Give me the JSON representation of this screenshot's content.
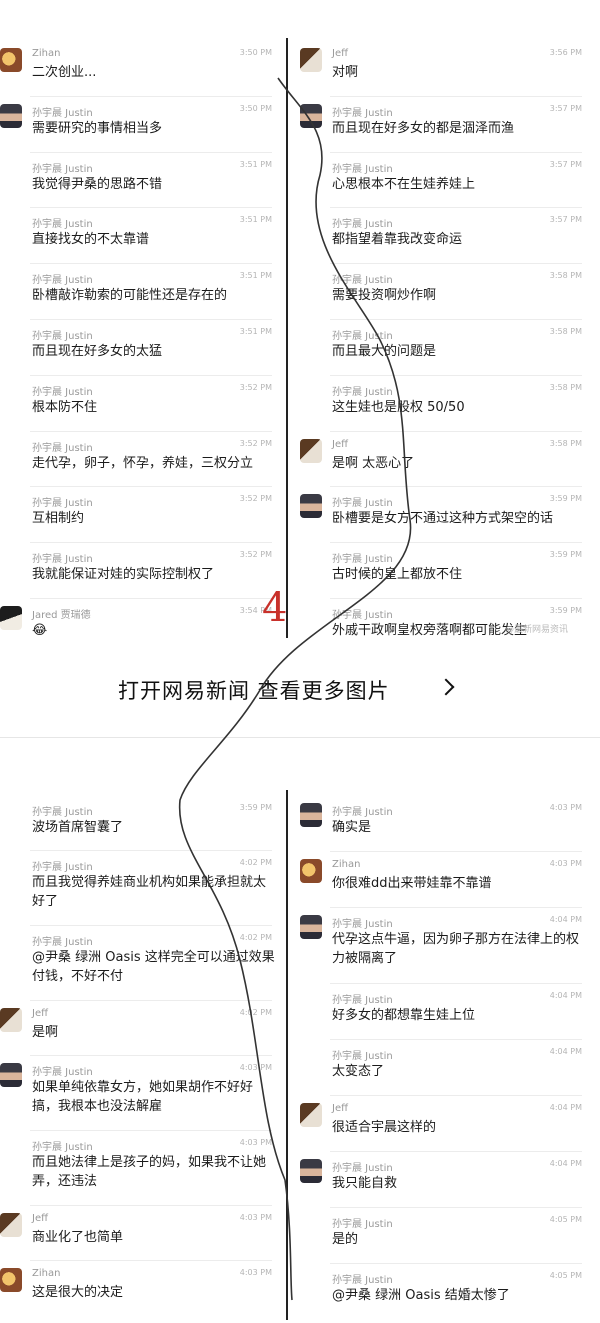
{
  "page_num": "4",
  "watermark": "@最新网易资讯",
  "banner": {
    "text": "打开网易新闻 查看更多图片"
  },
  "colors": {
    "page_num": "#c8312b",
    "divider": "#222222"
  },
  "top_left": [
    {
      "sender": "Zihan",
      "time": "3:50 PM",
      "text": "二次创业...",
      "avatar": "zihan"
    },
    {
      "sender": "孙宇晨 Justin",
      "time": "3:50 PM",
      "text": "需要研究的事情相当多",
      "avatar": "justin"
    },
    {
      "sender": "孙宇晨 Justin",
      "time": "3:51 PM",
      "text": "我觉得尹桑的思路不错",
      "avatar": ""
    },
    {
      "sender": "孙宇晨 Justin",
      "time": "3:51 PM",
      "text": "直接找女的不太靠谱",
      "avatar": ""
    },
    {
      "sender": "孙宇晨 Justin",
      "time": "3:51 PM",
      "text": "卧槽敲诈勒索的可能性还是存在的",
      "avatar": ""
    },
    {
      "sender": "孙宇晨 Justin",
      "time": "3:51 PM",
      "text": "而且现在好多女的太猛",
      "avatar": ""
    },
    {
      "sender": "孙宇晨 Justin",
      "time": "3:52 PM",
      "text": "根本防不住",
      "avatar": ""
    },
    {
      "sender": "孙宇晨 Justin",
      "time": "3:52 PM",
      "text": "走代孕，卵子，怀孕，养娃，三权分立",
      "avatar": ""
    },
    {
      "sender": "孙宇晨 Justin",
      "time": "3:52 PM",
      "text": "互相制约",
      "avatar": ""
    },
    {
      "sender": "孙宇晨 Justin",
      "time": "3:52 PM",
      "text": "我就能保证对娃的实际控制权了",
      "avatar": ""
    },
    {
      "sender": "Jared 贾瑞德",
      "time": "3:54 PM",
      "text": "😂",
      "avatar": "jared"
    }
  ],
  "top_right": [
    {
      "sender": "Jeff",
      "time": "3:56 PM",
      "text": "对啊",
      "avatar": "jeff"
    },
    {
      "sender": "孙宇晨 Justin",
      "time": "3:57 PM",
      "text": "而且现在好多女的都是涸泽而渔",
      "avatar": "justin"
    },
    {
      "sender": "孙宇晨 Justin",
      "time": "3:57 PM",
      "text": "心思根本不在生娃养娃上",
      "avatar": ""
    },
    {
      "sender": "孙宇晨 Justin",
      "time": "3:57 PM",
      "text": "都指望着靠我改变命运",
      "avatar": ""
    },
    {
      "sender": "孙宇晨 Justin",
      "time": "3:58 PM",
      "text": "需要投资啊炒作啊",
      "avatar": ""
    },
    {
      "sender": "孙宇晨 Justin",
      "time": "3:58 PM",
      "text": "而且最大的问题是",
      "avatar": ""
    },
    {
      "sender": "孙宇晨 Justin",
      "time": "3:58 PM",
      "text": "这生娃也是股权 50/50",
      "avatar": ""
    },
    {
      "sender": "Jeff",
      "time": "3:58 PM",
      "text": "是啊 太恶心了",
      "avatar": "jeff"
    },
    {
      "sender": "孙宇晨 Justin",
      "time": "3:59 PM",
      "text": "卧槽要是女方不通过这种方式架空的话",
      "avatar": "justin"
    },
    {
      "sender": "孙宇晨 Justin",
      "time": "3:59 PM",
      "text": "古时候的皇上都放不住",
      "avatar": ""
    },
    {
      "sender": "孙宇晨 Justin",
      "time": "3:59 PM",
      "text": "外戚干政啊皇权旁落啊都可能发生",
      "avatar": ""
    }
  ],
  "bottom_left": [
    {
      "sender": "孙宇晨 Justin",
      "time": "3:59 PM",
      "text": "波场首席智囊了",
      "avatar": ""
    },
    {
      "sender": "孙宇晨 Justin",
      "time": "4:02 PM",
      "text": "而且我觉得养娃商业机构如果能承担就太好了",
      "avatar": ""
    },
    {
      "sender": "孙宇晨 Justin",
      "time": "4:02 PM",
      "text": "@尹桑 绿洲 Oasis 这样完全可以通过效果付钱，不好不付",
      "avatar": ""
    },
    {
      "sender": "Jeff",
      "time": "4:02 PM",
      "text": "是啊",
      "avatar": "jeff"
    },
    {
      "sender": "孙宇晨 Justin",
      "time": "4:03 PM",
      "text": "如果单纯依靠女方，她如果胡作不好好搞，我根本也没法解雇",
      "avatar": "justin"
    },
    {
      "sender": "孙宇晨 Justin",
      "time": "4:03 PM",
      "text": "而且她法律上是孩子的妈，如果我不让她弄，还违法",
      "avatar": ""
    },
    {
      "sender": "Jeff",
      "time": "4:03 PM",
      "text": "商业化了也简单",
      "avatar": "jeff"
    },
    {
      "sender": "Zihan",
      "time": "4:03 PM",
      "text": "这是很大的决定",
      "avatar": "zihan"
    }
  ],
  "bottom_right": [
    {
      "sender": "孙宇晨 Justin",
      "time": "4:03 PM",
      "text": "确实是",
      "avatar": "justin"
    },
    {
      "sender": "Zihan",
      "time": "4:03 PM",
      "text": "你很难dd出来带娃靠不靠谱",
      "avatar": "zihan"
    },
    {
      "sender": "孙宇晨 Justin",
      "time": "4:04 PM",
      "text": "代孕这点牛逼，因为卵子那方在法律上的权力被隔离了",
      "avatar": "justin"
    },
    {
      "sender": "孙宇晨 Justin",
      "time": "4:04 PM",
      "text": "好多女的都想靠生娃上位",
      "avatar": ""
    },
    {
      "sender": "孙宇晨 Justin",
      "time": "4:04 PM",
      "text": "太变态了",
      "avatar": ""
    },
    {
      "sender": "Jeff",
      "time": "4:04 PM",
      "text": "很适合宇晨这样的",
      "avatar": "jeff"
    },
    {
      "sender": "孙宇晨 Justin",
      "time": "4:04 PM",
      "text": "我只能自救",
      "avatar": "justin"
    },
    {
      "sender": "孙宇晨 Justin",
      "time": "4:05 PM",
      "text": "是的",
      "avatar": ""
    },
    {
      "sender": "孙宇晨 Justin",
      "time": "4:05 PM",
      "text": "@尹桑 绿洲 Oasis 结婚太惨了",
      "avatar": ""
    }
  ]
}
